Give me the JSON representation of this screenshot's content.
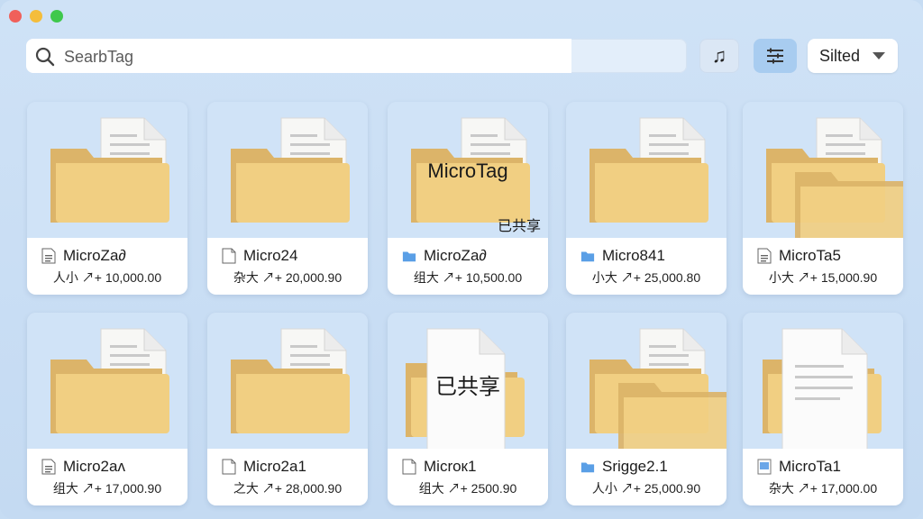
{
  "window": {
    "traffic_lights": [
      "close",
      "minimize",
      "zoom"
    ]
  },
  "toolbar": {
    "search_placeholder": "SearbTag",
    "music_icon": "♫",
    "sort_label": "Silted"
  },
  "files": [
    {
      "name": "MicroZa∂",
      "size": "人小 ↗+ 10,000.00",
      "type": "doc",
      "thumb": "folder-doc"
    },
    {
      "name": "Micro24",
      "size": "杂大 ↗+ 20,000.90",
      "type": "page",
      "thumb": "folder-page"
    },
    {
      "name": "MicroZa∂",
      "size": "组大 ↗+ 10,500.00",
      "type": "folder",
      "thumb": "folder-shared",
      "overlay": "MicroTag",
      "shared": "已共享"
    },
    {
      "name": "Micro841",
      "size": "小大 ↗+ 25,000.80",
      "type": "folder",
      "thumb": "folder-page"
    },
    {
      "name": "MicroTa5",
      "size": "小大 ↗+ 15,000.90",
      "type": "doc",
      "thumb": "folder-multi"
    },
    {
      "name": "Micro2aʌ",
      "size": "组大 ↗+ 17,000.90",
      "type": "doc",
      "thumb": "folder-doc"
    },
    {
      "name": "Micro2a1",
      "size": "之大 ↗+ 28,000.90",
      "type": "page",
      "thumb": "folder-page"
    },
    {
      "name": "Microк1",
      "size": "组大 ↗+ 2500.90",
      "type": "page",
      "thumb": "doc-shared",
      "overlay": "已共享"
    },
    {
      "name": "Srigge2.1",
      "size": "人小 ↗+ 25,000.90",
      "type": "folder",
      "thumb": "folder-multi"
    },
    {
      "name": "MicroTa1",
      "size": "杂大 ↗+ 17,000.00",
      "type": "image",
      "thumb": "doc-folder"
    }
  ]
}
